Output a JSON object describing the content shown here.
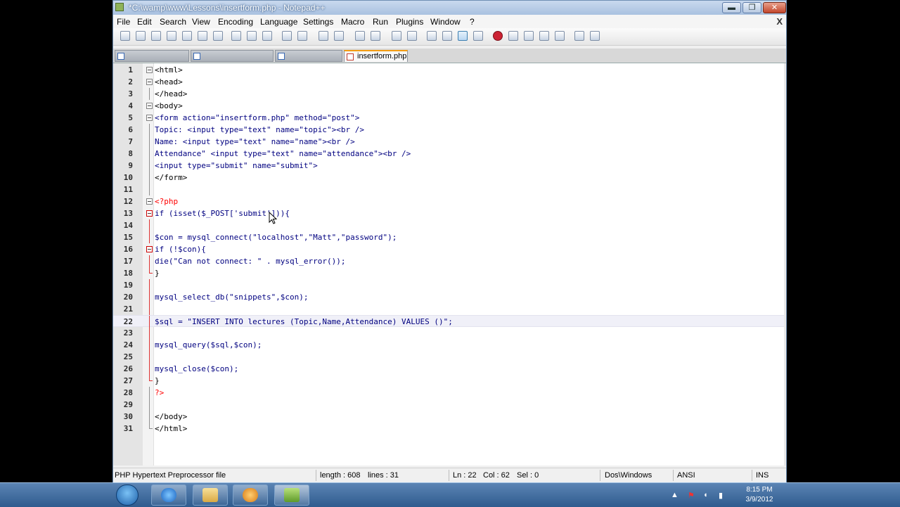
{
  "window": {
    "title": "*C:\\wamp\\www\\Lessons\\insertform.php - Notepad++"
  },
  "window_controls": {
    "minimize": "▬",
    "maximize": "❐",
    "close": "✕"
  },
  "menu": {
    "items": [
      "File",
      "Edit",
      "Search",
      "View",
      "Encoding",
      "Language",
      "Settings",
      "Macro",
      "Run",
      "Plugins",
      "Window",
      "?"
    ],
    "close_glyph": "X"
  },
  "tabs": [
    {
      "label": ""
    },
    {
      "label": ""
    },
    {
      "label": ""
    },
    {
      "label": "insertform.php"
    }
  ],
  "editor": {
    "lines": [
      {
        "num": "1",
        "text": "<html>"
      },
      {
        "num": "2",
        "text": "<head>"
      },
      {
        "num": "3",
        "text": "</head>"
      },
      {
        "num": "4",
        "text": "<body>"
      },
      {
        "num": "5",
        "text": "<form action=\"insertform.php\" method=\"post\">"
      },
      {
        "num": "6",
        "text": "Topic: <input type=\"text\" name=\"topic\"><br />"
      },
      {
        "num": "7",
        "text": "Name: <input type=\"text\" name=\"name\"><br />"
      },
      {
        "num": "8",
        "text": "Attendance\" <input type=\"text\" name=\"attendance\"><br />"
      },
      {
        "num": "9",
        "text": "<input type=\"submit\" name=\"submit\">"
      },
      {
        "num": "10",
        "text": "</form>"
      },
      {
        "num": "11",
        "text": ""
      },
      {
        "num": "12",
        "text": "<?php"
      },
      {
        "num": "13",
        "text": "if (isset($_POST['submit'])){"
      },
      {
        "num": "14",
        "text": ""
      },
      {
        "num": "15",
        "text": "$con = mysql_connect(\"localhost\",\"Matt\",\"password\");"
      },
      {
        "num": "16",
        "text": "if (!$con){"
      },
      {
        "num": "17",
        "text": "die(\"Can not connect: \" . mysql_error());"
      },
      {
        "num": "18",
        "text": "}"
      },
      {
        "num": "19",
        "text": ""
      },
      {
        "num": "20",
        "text": "mysql_select_db(\"snippets\",$con);"
      },
      {
        "num": "21",
        "text": ""
      },
      {
        "num": "22",
        "text": "$sql = \"INSERT INTO lectures (Topic,Name,Attendance) VALUES ()\";"
      },
      {
        "num": "23",
        "text": ""
      },
      {
        "num": "24",
        "text": "mysql_query($sql,$con);"
      },
      {
        "num": "25",
        "text": ""
      },
      {
        "num": "26",
        "text": "mysql_close($con);"
      },
      {
        "num": "27",
        "text": "}"
      },
      {
        "num": "28",
        "text": "?>"
      },
      {
        "num": "29",
        "text": ""
      },
      {
        "num": "30",
        "text": "</body>"
      },
      {
        "num": "31",
        "text": "</html>"
      }
    ]
  },
  "status": {
    "file_type": "PHP Hypertext Preprocessor file",
    "length": "length : 608",
    "lines": "lines : 31",
    "ln": "Ln : 22",
    "col": "Col : 62",
    "sel": "Sel : 0",
    "eol": "Dos\\Windows",
    "encoding": "ANSI",
    "mode": "INS"
  },
  "taskbar": {
    "time": "8:15 PM",
    "date": "3/9/2012"
  },
  "icons": {
    "start": "windows-start-icon",
    "tray_up": "▲",
    "tray_flag": "⚑",
    "tray_volume": "◖",
    "tray_network": "▮"
  },
  "colors": {
    "keyword": "#0000ff",
    "string": "#808080",
    "function": "#000080",
    "tag": "#000000",
    "php_tag": "#ff0000",
    "active_tab_accent": "#f39c12"
  }
}
